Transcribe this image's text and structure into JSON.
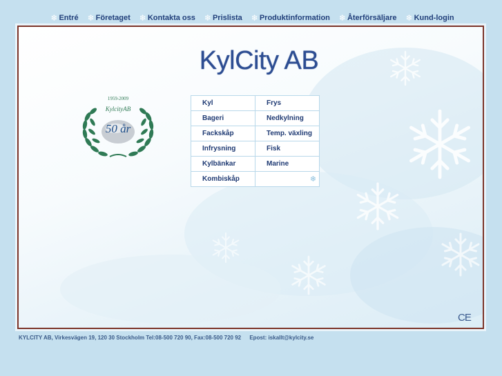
{
  "nav": {
    "items": [
      {
        "label": "Entré"
      },
      {
        "label": "Företaget"
      },
      {
        "label": "Kontakta oss"
      },
      {
        "label": "Prislista"
      },
      {
        "label": "Produktinformation"
      },
      {
        "label": "Återförsäljare"
      },
      {
        "label": "Kund-login"
      }
    ]
  },
  "header": {
    "title": "KylCity AB"
  },
  "badge": {
    "years": "1959-2009",
    "name": "KylcityAB",
    "anniversary": "50 år"
  },
  "categories": {
    "rows": [
      [
        "Kyl",
        "Frys"
      ],
      [
        "Bageri",
        "Nedkylning"
      ],
      [
        "Fackskåp",
        "Temp. växling"
      ],
      [
        "Infrysning",
        "Fisk"
      ],
      [
        "Kylbänkar",
        "Marine"
      ],
      [
        "Kombiskåp",
        ""
      ]
    ]
  },
  "ce": "CE",
  "footer": {
    "address": "KYLCITY AB, Virkesvägen 19, 120 30 Stockholm  Tel:08-500 720 90, Fax:08-500 720 92",
    "email": "Epost: iskallt@kylcity.se"
  },
  "colors": {
    "background": "#c5e0ef",
    "frame": "#7b3328",
    "title": "#2d4d92",
    "nav_text": "#213f7a",
    "laurel": "#2f7a55"
  }
}
